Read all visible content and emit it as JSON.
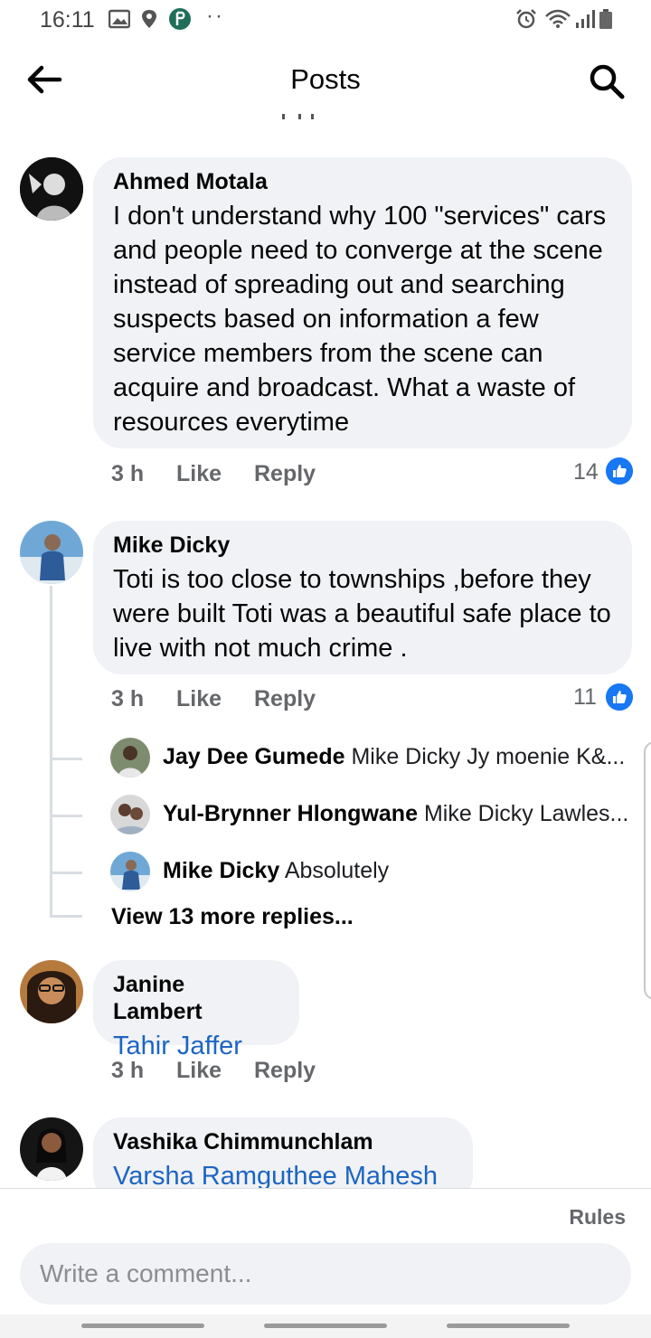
{
  "status_bar": {
    "time": "16:11",
    "overflow": "··",
    "left_icons": [
      "image-icon",
      "location-pin-icon",
      "app-p-icon"
    ],
    "right_icons": [
      "alarm-icon",
      "wifi-icon",
      "signal-icon",
      "battery-icon"
    ]
  },
  "header": {
    "title": "Posts",
    "back_icon": "arrow-left-icon",
    "search_icon": "search-icon"
  },
  "comments": [
    {
      "author": "Ahmed Motala",
      "text": "I don't understand why 100 \"services\" cars and people need to converge at the scene instead of spreading out and searching suspects based on information a few service members from the scene can acquire and broadcast. What a waste of resources everytime",
      "time": "3 h",
      "like_label": "Like",
      "reply_label": "Reply",
      "reactions": "14"
    },
    {
      "author": "Mike Dicky",
      "text": "Toti is too close to townships ,before they were built Toti was a beautiful safe place to live with not much crime .",
      "time": "3 h",
      "like_label": "Like",
      "reply_label": "Reply",
      "reactions": "11",
      "replies": [
        {
          "name": "Jay Dee Gumede",
          "snippet": "Mike Dicky  Jy moenie K&..."
        },
        {
          "name": "Yul-Brynner Hlongwane",
          "snippet": "Mike Dicky Lawles..."
        },
        {
          "name": "Mike Dicky",
          "snippet": "Absolutely"
        }
      ],
      "view_more": "View 13 more replies..."
    },
    {
      "author": "Janine Lambert",
      "mention": "Tahir Jaffer",
      "time": "3 h",
      "like_label": "Like",
      "reply_label": "Reply"
    },
    {
      "author": "Vashika Chimmunchlam",
      "mention": "Varsha Ramguthee Mahesh"
    }
  ],
  "composer": {
    "rules_label": "Rules",
    "placeholder": "Write a comment..."
  },
  "colors": {
    "bubble": "#f0f2f5",
    "mention": "#1d65c1",
    "like_blue": "#1877f2",
    "meta_gray": "#65676b"
  }
}
